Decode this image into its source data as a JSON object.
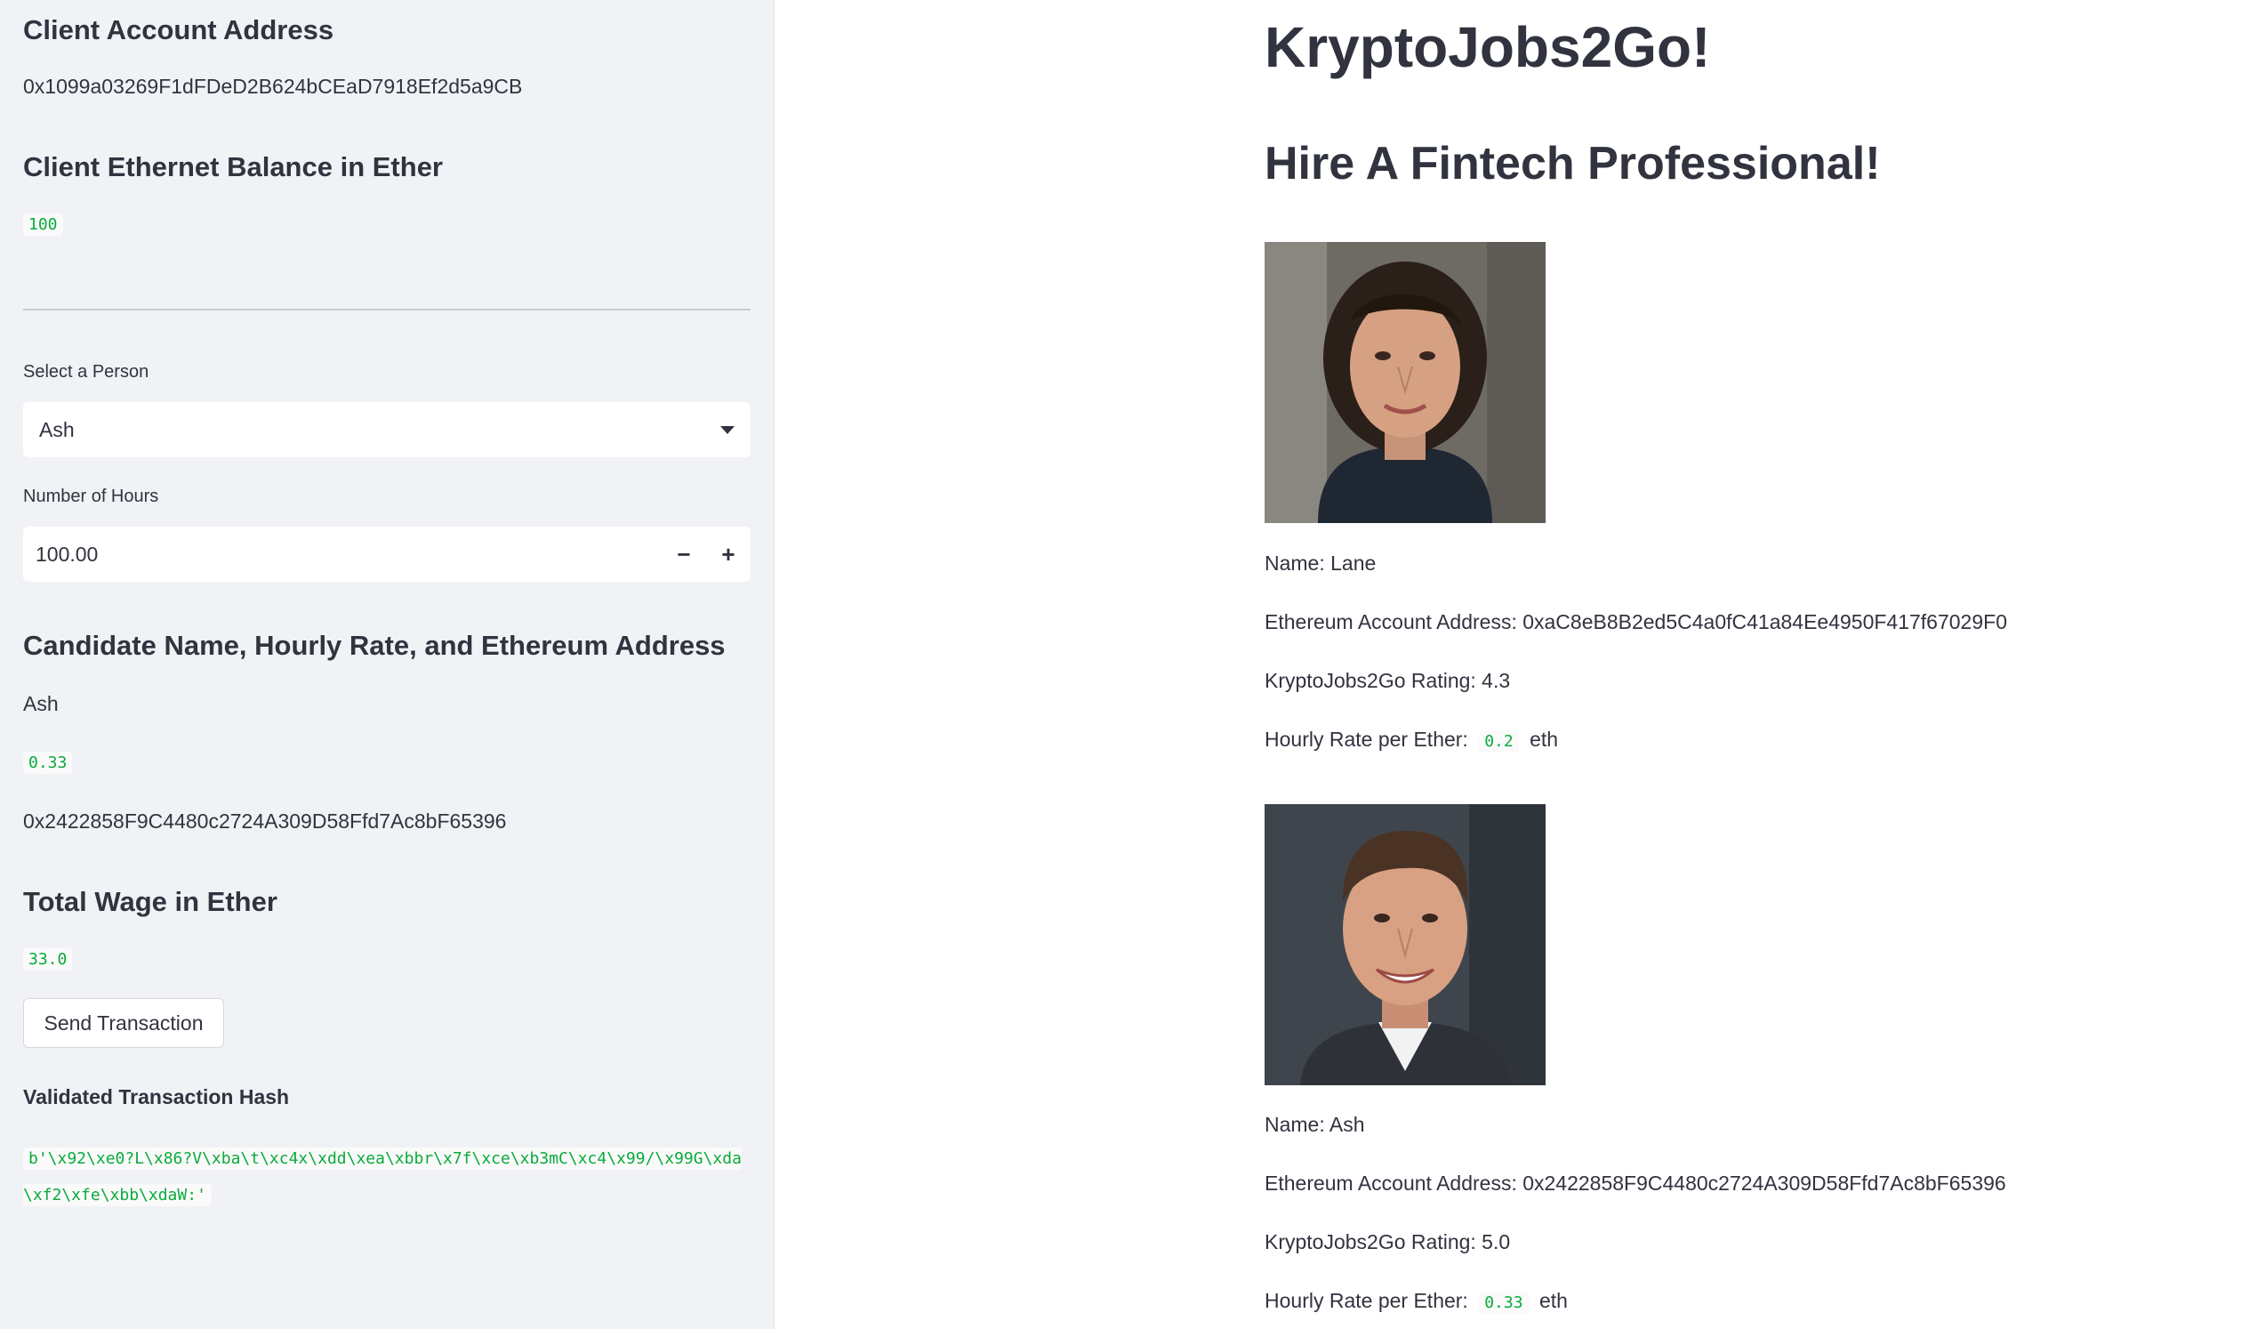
{
  "sidebar": {
    "client_account_header": "Client Account Address",
    "client_account_address": "0x1099a03269F1dFDeD2B624bCEaD7918Ef2d5a9CB",
    "balance_header": "Client Ethernet Balance in Ether",
    "balance_value": "100",
    "select_label": "Select a Person",
    "select_value": "Ash",
    "hours_label": "Number of Hours",
    "hours_value": "100.00",
    "decrement_label": "−",
    "increment_label": "+",
    "candidate_header": "Candidate Name, Hourly Rate, and Ethereum Address",
    "candidate_name": "Ash",
    "candidate_rate": "0.33",
    "candidate_address": "0x2422858F9C4480c2724A309D58Ffd7Ac8bF65396",
    "wage_header": "Total Wage in Ether",
    "wage_value": "33.0",
    "send_button_label": "Send Transaction",
    "hash_label": "Validated Transaction Hash",
    "hash_value": "b'\\x92\\xe0?L\\x86?V\\xba\\t\\xc4x\\xdd\\xea\\xbbr\\x7f\\xce\\xb3mC\\xc4\\x99/\\x99G\\xda\\xf2\\xfe\\xbb\\xdaW:'"
  },
  "main": {
    "title": "KryptoJobs2Go!",
    "subtitle": "Hire A Fintech Professional!",
    "candidates": [
      {
        "name": "Name: Lane",
        "address": "Ethereum Account Address: 0xaC8eB8B2ed5C4a0fC41a84Ee4950F417f67029F0",
        "rating": "KryptoJobs2Go Rating: 4.3",
        "rate_prefix": "Hourly Rate per Ether:",
        "rate_value": "0.2",
        "rate_suffix": "eth"
      },
      {
        "name": "Name: Ash",
        "address": "Ethereum Account Address: 0x2422858F9C4480c2724A309D58Ffd7Ac8bF65396",
        "rating": "KryptoJobs2Go Rating: 5.0",
        "rate_prefix": "Hourly Rate per Ether:",
        "rate_value": "0.33",
        "rate_suffix": "eth"
      }
    ]
  },
  "colors": {
    "sidebar_bg": "#f0f2f6",
    "text": "#31333f",
    "code_green": "#09ab3b"
  }
}
